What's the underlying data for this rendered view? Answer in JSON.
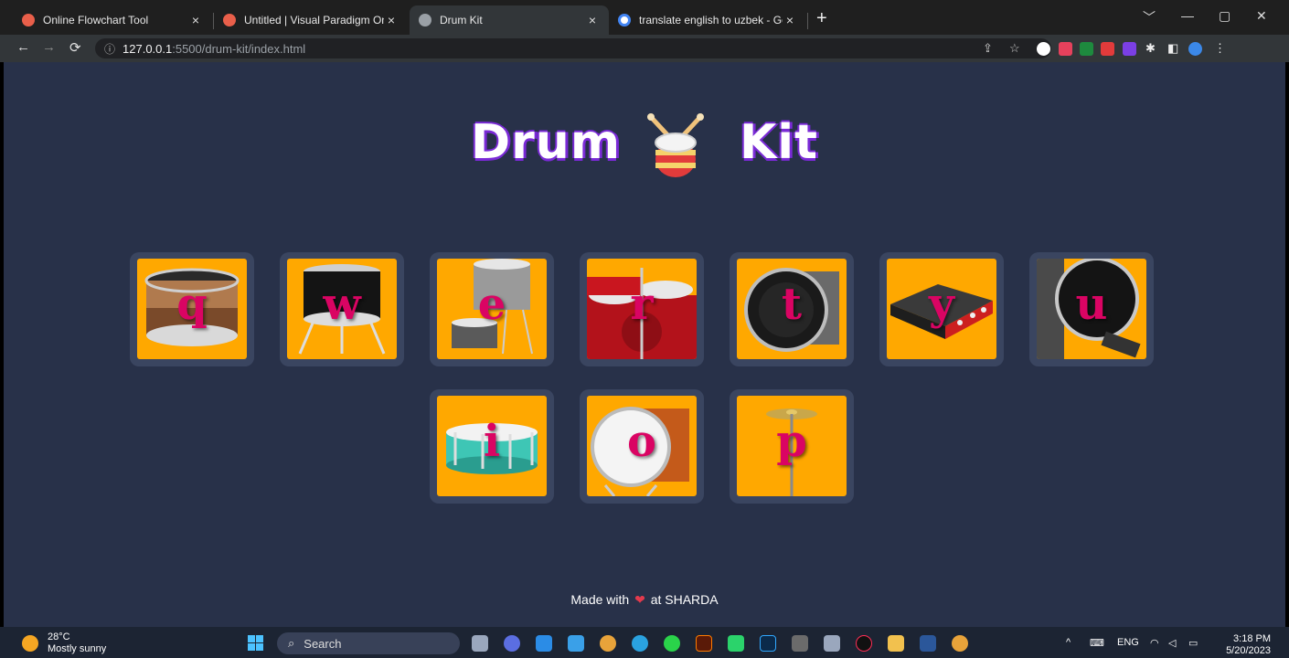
{
  "browser": {
    "tabs": [
      {
        "title": "Online Flowchart Tool",
        "favicon_color": "#e95f4a",
        "active": false
      },
      {
        "title": "Untitled | Visual Paradigm Online",
        "favicon_color": "#e95f4a",
        "active": false
      },
      {
        "title": "Drum Kit",
        "favicon_color": "#9aa0a6",
        "active": true
      },
      {
        "title": "translate english to uzbek - Goo",
        "favicon_color": "#4285f4",
        "active": false
      }
    ],
    "close_glyph": "×",
    "new_tab_glyph": "+",
    "url_host": "127.0.0.1",
    "url_path": ":5500/drum-kit/index.html",
    "window_controls": [
      "﹀",
      "—",
      "▢",
      "✕"
    ]
  },
  "page": {
    "title_left": "Drum",
    "title_right": "Kit",
    "drums": [
      {
        "key": "q",
        "sound": "tom"
      },
      {
        "key": "w",
        "sound": "tom"
      },
      {
        "key": "e",
        "sound": "tom set"
      },
      {
        "key": "r",
        "sound": "drum set"
      },
      {
        "key": "t",
        "sound": "bass drum"
      },
      {
        "key": "y",
        "sound": "amplifier"
      },
      {
        "key": "u",
        "sound": "kick drum"
      },
      {
        "key": "i",
        "sound": "snare"
      },
      {
        "key": "o",
        "sound": "bass drum"
      },
      {
        "key": "p",
        "sound": "cymbal"
      }
    ],
    "footer_prefix": "Made with",
    "footer_heart": "❤",
    "footer_suffix": "at SHARDA"
  },
  "taskbar": {
    "weather_temp": "28°C",
    "weather_desc": "Mostly sunny",
    "search_placeholder": "Search",
    "tray_lang": "ENG",
    "time": "3:18 PM",
    "date": "5/20/2023"
  }
}
